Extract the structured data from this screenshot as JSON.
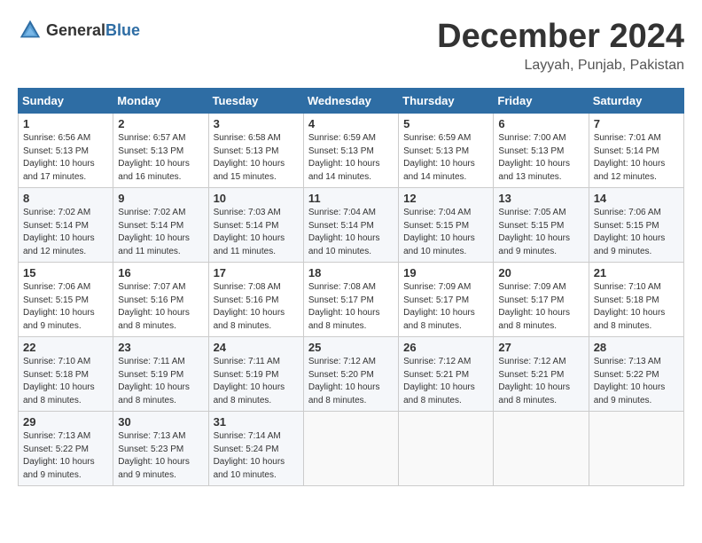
{
  "header": {
    "logo_general": "General",
    "logo_blue": "Blue",
    "title": "December 2024",
    "location": "Layyah, Punjab, Pakistan"
  },
  "weekdays": [
    "Sunday",
    "Monday",
    "Tuesday",
    "Wednesday",
    "Thursday",
    "Friday",
    "Saturday"
  ],
  "weeks": [
    [
      {
        "day": "1",
        "sunrise": "6:56 AM",
        "sunset": "5:13 PM",
        "daylight": "10 hours and 17 minutes."
      },
      {
        "day": "2",
        "sunrise": "6:57 AM",
        "sunset": "5:13 PM",
        "daylight": "10 hours and 16 minutes."
      },
      {
        "day": "3",
        "sunrise": "6:58 AM",
        "sunset": "5:13 PM",
        "daylight": "10 hours and 15 minutes."
      },
      {
        "day": "4",
        "sunrise": "6:59 AM",
        "sunset": "5:13 PM",
        "daylight": "10 hours and 14 minutes."
      },
      {
        "day": "5",
        "sunrise": "6:59 AM",
        "sunset": "5:13 PM",
        "daylight": "10 hours and 14 minutes."
      },
      {
        "day": "6",
        "sunrise": "7:00 AM",
        "sunset": "5:13 PM",
        "daylight": "10 hours and 13 minutes."
      },
      {
        "day": "7",
        "sunrise": "7:01 AM",
        "sunset": "5:14 PM",
        "daylight": "10 hours and 12 minutes."
      }
    ],
    [
      {
        "day": "8",
        "sunrise": "7:02 AM",
        "sunset": "5:14 PM",
        "daylight": "10 hours and 12 minutes."
      },
      {
        "day": "9",
        "sunrise": "7:02 AM",
        "sunset": "5:14 PM",
        "daylight": "10 hours and 11 minutes."
      },
      {
        "day": "10",
        "sunrise": "7:03 AM",
        "sunset": "5:14 PM",
        "daylight": "10 hours and 11 minutes."
      },
      {
        "day": "11",
        "sunrise": "7:04 AM",
        "sunset": "5:14 PM",
        "daylight": "10 hours and 10 minutes."
      },
      {
        "day": "12",
        "sunrise": "7:04 AM",
        "sunset": "5:15 PM",
        "daylight": "10 hours and 10 minutes."
      },
      {
        "day": "13",
        "sunrise": "7:05 AM",
        "sunset": "5:15 PM",
        "daylight": "10 hours and 9 minutes."
      },
      {
        "day": "14",
        "sunrise": "7:06 AM",
        "sunset": "5:15 PM",
        "daylight": "10 hours and 9 minutes."
      }
    ],
    [
      {
        "day": "15",
        "sunrise": "7:06 AM",
        "sunset": "5:15 PM",
        "daylight": "10 hours and 9 minutes."
      },
      {
        "day": "16",
        "sunrise": "7:07 AM",
        "sunset": "5:16 PM",
        "daylight": "10 hours and 8 minutes."
      },
      {
        "day": "17",
        "sunrise": "7:08 AM",
        "sunset": "5:16 PM",
        "daylight": "10 hours and 8 minutes."
      },
      {
        "day": "18",
        "sunrise": "7:08 AM",
        "sunset": "5:17 PM",
        "daylight": "10 hours and 8 minutes."
      },
      {
        "day": "19",
        "sunrise": "7:09 AM",
        "sunset": "5:17 PM",
        "daylight": "10 hours and 8 minutes."
      },
      {
        "day": "20",
        "sunrise": "7:09 AM",
        "sunset": "5:17 PM",
        "daylight": "10 hours and 8 minutes."
      },
      {
        "day": "21",
        "sunrise": "7:10 AM",
        "sunset": "5:18 PM",
        "daylight": "10 hours and 8 minutes."
      }
    ],
    [
      {
        "day": "22",
        "sunrise": "7:10 AM",
        "sunset": "5:18 PM",
        "daylight": "10 hours and 8 minutes."
      },
      {
        "day": "23",
        "sunrise": "7:11 AM",
        "sunset": "5:19 PM",
        "daylight": "10 hours and 8 minutes."
      },
      {
        "day": "24",
        "sunrise": "7:11 AM",
        "sunset": "5:19 PM",
        "daylight": "10 hours and 8 minutes."
      },
      {
        "day": "25",
        "sunrise": "7:12 AM",
        "sunset": "5:20 PM",
        "daylight": "10 hours and 8 minutes."
      },
      {
        "day": "26",
        "sunrise": "7:12 AM",
        "sunset": "5:21 PM",
        "daylight": "10 hours and 8 minutes."
      },
      {
        "day": "27",
        "sunrise": "7:12 AM",
        "sunset": "5:21 PM",
        "daylight": "10 hours and 8 minutes."
      },
      {
        "day": "28",
        "sunrise": "7:13 AM",
        "sunset": "5:22 PM",
        "daylight": "10 hours and 9 minutes."
      }
    ],
    [
      {
        "day": "29",
        "sunrise": "7:13 AM",
        "sunset": "5:22 PM",
        "daylight": "10 hours and 9 minutes."
      },
      {
        "day": "30",
        "sunrise": "7:13 AM",
        "sunset": "5:23 PM",
        "daylight": "10 hours and 9 minutes."
      },
      {
        "day": "31",
        "sunrise": "7:14 AM",
        "sunset": "5:24 PM",
        "daylight": "10 hours and 10 minutes."
      },
      null,
      null,
      null,
      null
    ]
  ]
}
